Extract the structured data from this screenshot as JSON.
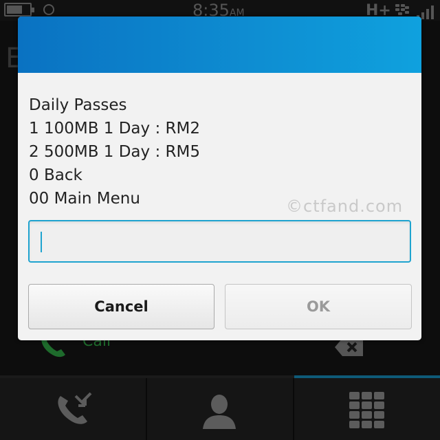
{
  "status_bar": {
    "time": "8:35",
    "ampm": "AM",
    "network": "H+"
  },
  "background": {
    "call_label": "Call"
  },
  "dialog": {
    "lines": [
      "Daily Passes",
      "1 100MB 1 Day : RM2",
      "2 500MB 1 Day : RM5",
      "0 Back",
      "00 Main Menu"
    ],
    "watermark": "©ctfand.com",
    "input_value": "",
    "cancel_label": "Cancel",
    "ok_label": "OK"
  },
  "colors": {
    "header_gradient_start": "#0a72c2",
    "header_gradient_end": "#0fa1de",
    "input_border": "#1ea3cf",
    "ok_disabled_text": "#9a9a9a"
  },
  "icons": {
    "dock": [
      "call-log-icon",
      "contacts-icon",
      "dialpad-icon"
    ]
  }
}
